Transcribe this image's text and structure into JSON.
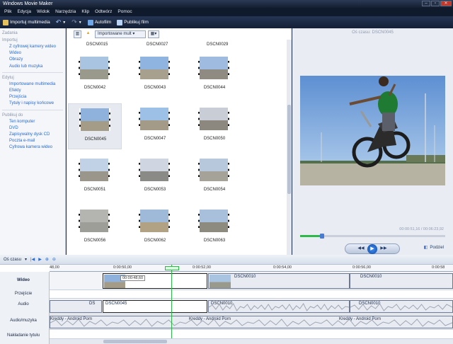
{
  "window": {
    "title": "Windows Movie Maker"
  },
  "menu": [
    "Plik",
    "Edycja",
    "Widok",
    "Narzędzia",
    "Klip",
    "Odtwórz",
    "Pomoc"
  ],
  "toolbar": {
    "import": "Importuj multimedia",
    "autofilm": "Autofilm",
    "publish": "Publikuj film"
  },
  "tasks": {
    "header": "Zadania",
    "sections": [
      {
        "title": "Importuj",
        "items": [
          "Z cyfrowej kamery wideo",
          "Wideo",
          "Obrazy",
          "Audio lub muzyka"
        ]
      },
      {
        "title": "Edytuj",
        "items": [
          "Importowane multimedia",
          "Efekty",
          "Przejścia",
          "Tytuły i napisy końcowe"
        ]
      },
      {
        "title": "Publikuj do",
        "items": [
          "Ten komputer",
          "DVD",
          "Zapisywalny dysk CD",
          "Poczta e-mail",
          "Cyfrowa kamera wideo"
        ]
      }
    ]
  },
  "collection": {
    "selector": "Importowane mult",
    "top_labels": [
      "DSCN0015",
      "DSCN0027",
      "DSCN0029"
    ],
    "clips": [
      {
        "name": "DSCN0042",
        "selected": false,
        "sky": "#a9c4e0",
        "ground": "#9a9a8c"
      },
      {
        "name": "DSCN0043",
        "selected": false,
        "sky": "#8fb4df",
        "ground": "#a8a08e"
      },
      {
        "name": "DSCN0044",
        "selected": false,
        "sky": "#9fbbe0",
        "ground": "#8f8a82"
      },
      {
        "name": "DSCN0045",
        "selected": true,
        "sky": "#8fb2dc",
        "ground": "#a49c86"
      },
      {
        "name": "DSCN0047",
        "selected": false,
        "sky": "#9cc0e6",
        "ground": "#a49a88"
      },
      {
        "name": "DSCN0050",
        "selected": false,
        "sky": "#c9cdd6",
        "ground": "#8c8880"
      },
      {
        "name": "DSCN0051",
        "selected": false,
        "sky": "#c1d2e6",
        "ground": "#9a968c"
      },
      {
        "name": "DSCN0053",
        "selected": false,
        "sky": "#cfd6e2",
        "ground": "#8a8a86"
      },
      {
        "name": "DSCN0054",
        "selected": false,
        "sky": "#b8c8dc",
        "ground": "#a5a29a"
      },
      {
        "name": "DSCN0056",
        "selected": false,
        "sky": "#b4b4b0",
        "ground": "#9e9e98"
      },
      {
        "name": "DSCN0062",
        "selected": false,
        "sky": "#9fb9d8",
        "ground": "#b0a282"
      },
      {
        "name": "DSCN0063",
        "selected": false,
        "sky": "#a9c0dc",
        "ground": "#8d8a80"
      }
    ]
  },
  "preview": {
    "title": "Oś czasu: DSCN0045",
    "time": "00:00:51,16 / 00:06:23,92",
    "progress_fraction": 0.15,
    "split_label": "Podziel"
  },
  "timeline": {
    "view_label": "Oś czasu",
    "ruler_labels": [
      "48,00",
      "0:00:50,00",
      "0:00:52,00",
      "0:00:54,00",
      "0:00:56,00",
      "0:00:58"
    ],
    "track_labels": [
      "Wideo",
      "Przejście",
      "Audio",
      "Audio/muzyka",
      "Nakładanie tytułu"
    ],
    "tooltip": "00:00:48,60",
    "video_clips": [
      "DSCN0010",
      "DSCN0010"
    ],
    "audio_clips": [
      "DS",
      "DSCN0045",
      "DSCN0010",
      "DSCN0010"
    ],
    "music_label": "Kreddy - Android Porn"
  },
  "colors": {
    "accent_green": "#2fb84a",
    "link_blue": "#2a6bd0"
  }
}
